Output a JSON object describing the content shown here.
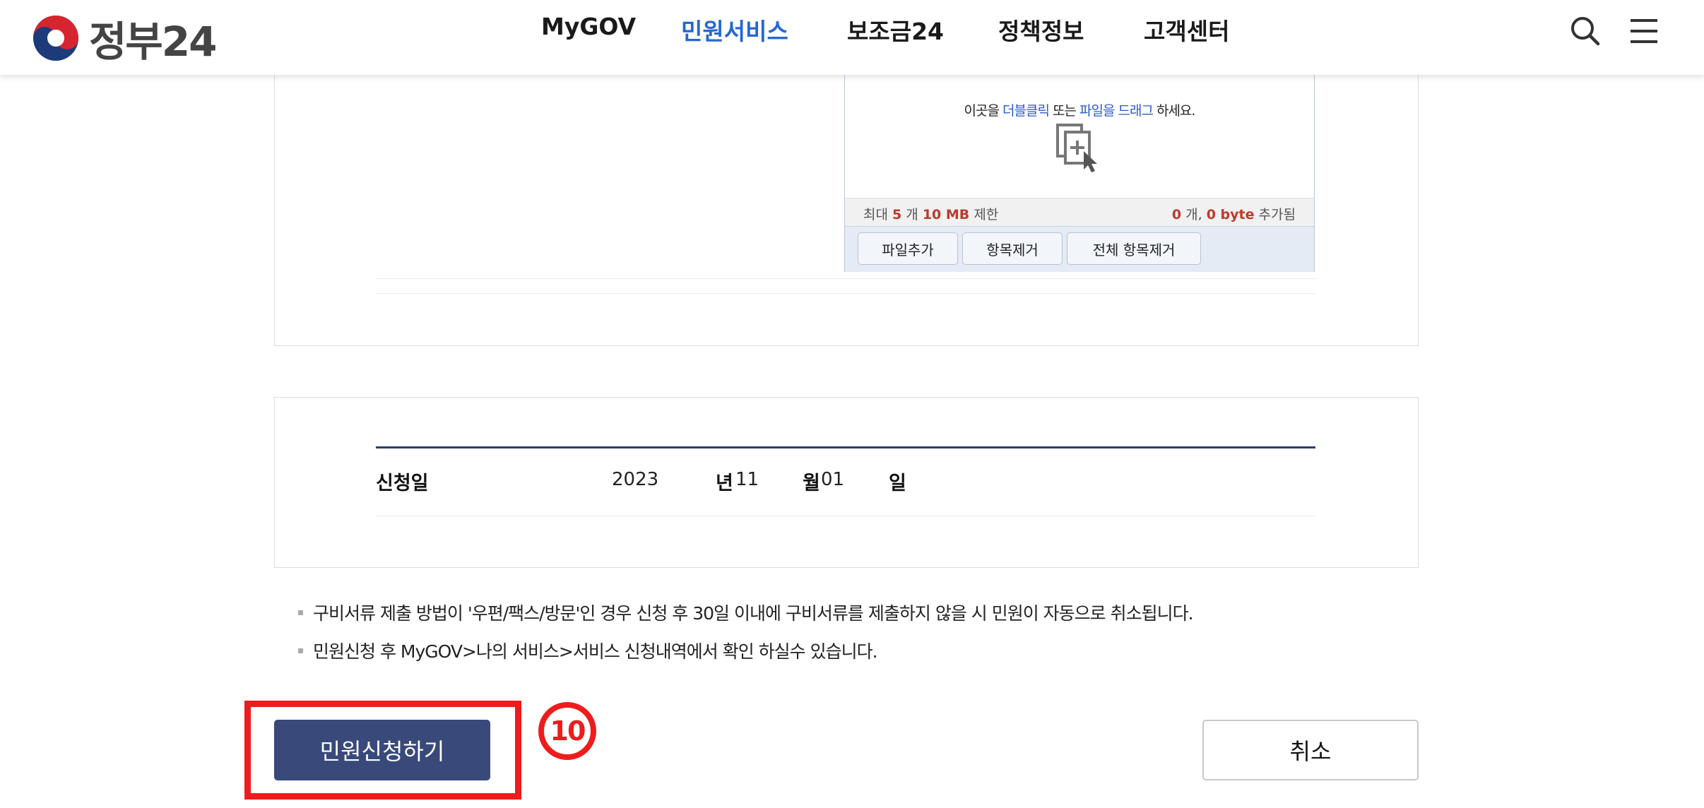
{
  "header": {
    "logo_text": "정부24",
    "nav": [
      "MyGOV",
      "민원서비스",
      "보조금24",
      "정책정보",
      "고객센터"
    ],
    "active_nav": "민원서비스"
  },
  "uploader": {
    "drop_prefix": "이곳을 ",
    "drop_hl1": "더블클릭",
    "drop_mid": " 또는 ",
    "drop_hl2": "파일을 드래그",
    "drop_suffix": " 하세요.",
    "limit_label": "최대",
    "limit_count": "5",
    "limit_count_unit": "개",
    "limit_size": "10 MB",
    "limit_suffix": "제한",
    "added_count": "0",
    "added_count_unit": "개,",
    "added_size": "0 byte",
    "added_suffix": "추가됨",
    "buttons": [
      "파일추가",
      "항목제거",
      "전체 항목제거"
    ]
  },
  "application_date": {
    "label": "신청일",
    "year": "2023",
    "year_unit": "년",
    "month": "11",
    "month_unit": "월",
    "day": "01",
    "day_unit": "일"
  },
  "notes": [
    "구비서류 제출 방법이 '우편/팩스/방문'인 경우 신청 후 30일 이내에 구비서류를 제출하지 않을 시 민원이 자동으로 취소됩니다.",
    "민원신청 후 MyGOV>나의 서비스>서비스 신청내역에서 확인 하실수 있습니다."
  ],
  "actions": {
    "submit": "민원신청하기",
    "cancel": "취소"
  },
  "annotation": {
    "step_number": "10",
    "color": "#ee1c1c"
  },
  "colors": {
    "brand_blue": "#2469d1",
    "submit_bg": "#38497a"
  }
}
